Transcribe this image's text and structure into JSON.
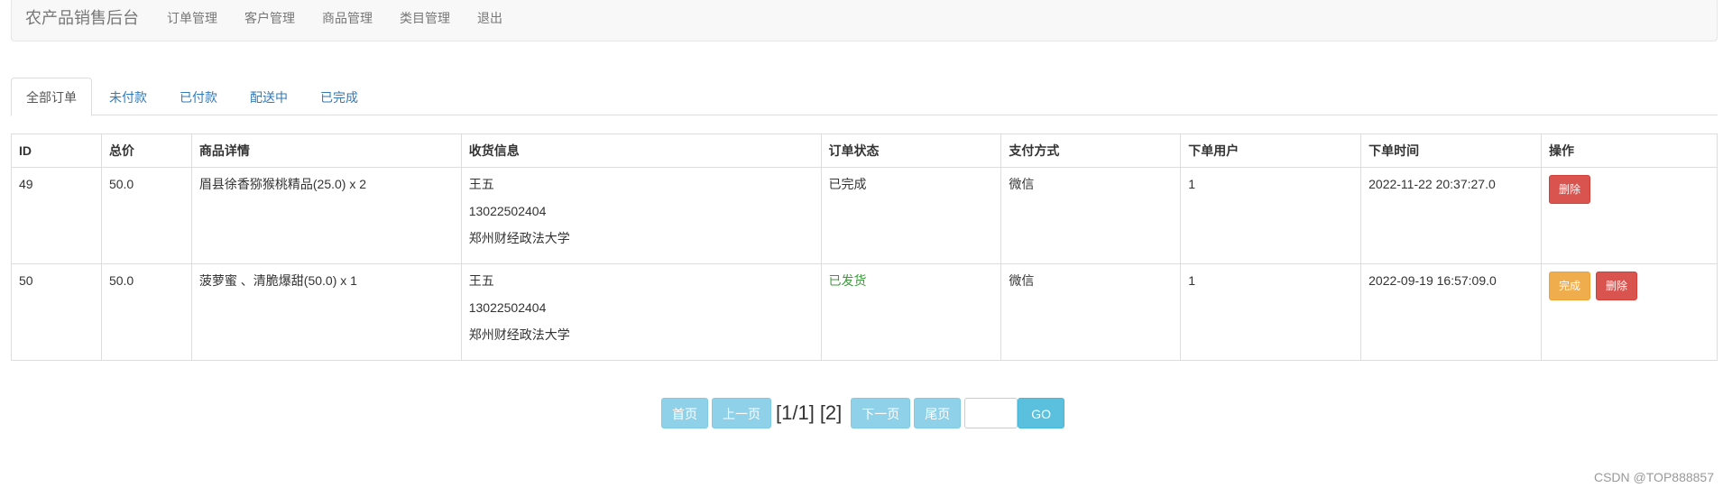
{
  "navbar": {
    "brand": "农产品销售后台",
    "links": [
      "订单管理",
      "客户管理",
      "商品管理",
      "类目管理",
      "退出"
    ]
  },
  "tabs": [
    "全部订单",
    "未付款",
    "已付款",
    "配送中",
    "已完成"
  ],
  "table": {
    "headers": [
      "ID",
      "总价",
      "商品详情",
      "收货信息",
      "订单状态",
      "支付方式",
      "下单用户",
      "下单时间",
      "操作"
    ],
    "rows": [
      {
        "id": "49",
        "total": "50.0",
        "items": "眉县徐香猕猴桃精品(25.0) x 2",
        "receiver_name": "王五",
        "receiver_phone": "13022502404",
        "receiver_address": "郑州财经政法大学",
        "status": "已完成",
        "payment": "微信",
        "user": "1",
        "time": "2022-11-22 20:37:27.0",
        "actions": [
          "删除"
        ]
      },
      {
        "id": "50",
        "total": "50.0",
        "items": "菠萝蜜 、清脆爆甜(50.0) x 1",
        "receiver_name": "王五",
        "receiver_phone": "13022502404",
        "receiver_address": "郑州财经政法大学",
        "status": "已发货",
        "payment": "微信",
        "user": "1",
        "time": "2022-09-19 16:57:09.0",
        "actions": [
          "完成",
          "删除"
        ]
      }
    ]
  },
  "pager": {
    "first": "首页",
    "prev": "上一页",
    "current": "[1/1]",
    "next_num": "[2]",
    "next": "下一页",
    "last": "尾页",
    "input_value": "",
    "go": "GO"
  },
  "watermark": "CSDN @TOP888857",
  "colors": {
    "link": "#337ab7",
    "danger": "#d9534f",
    "warning": "#f0ad4e",
    "info": "#5bc0de",
    "shipped_status": "#3c9a3c"
  }
}
